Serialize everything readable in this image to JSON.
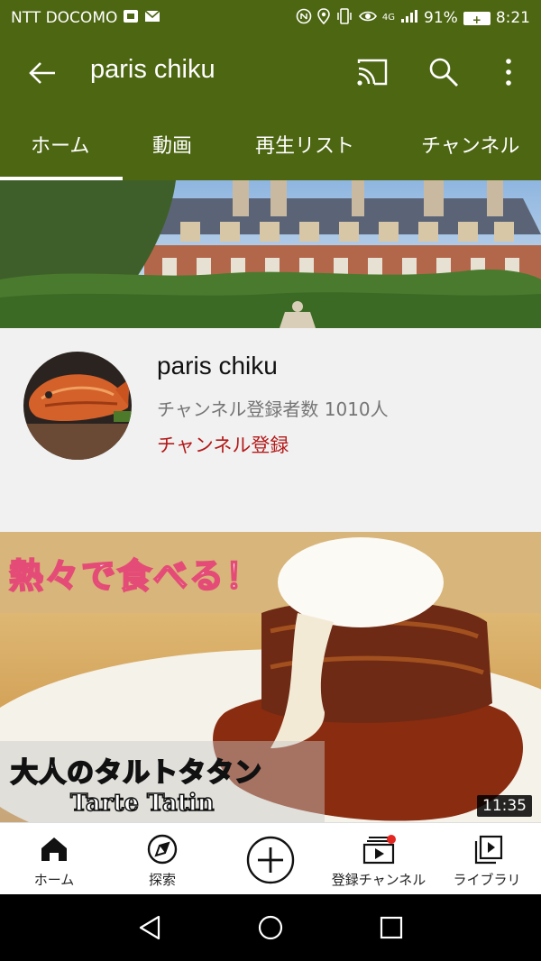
{
  "status_bar": {
    "carrier": "NTT DOCOMO",
    "network": "4G",
    "battery": "91%",
    "time": "8:21"
  },
  "app_bar": {
    "title": "paris chiku",
    "icons": [
      "back-arrow-icon",
      "cast-icon",
      "search-icon",
      "more-vert-icon"
    ]
  },
  "tabs": [
    {
      "label": "ホーム",
      "active": true
    },
    {
      "label": "動画"
    },
    {
      "label": "再生リスト"
    },
    {
      "label": "チャンネル"
    }
  ],
  "channel": {
    "name": "paris chiku",
    "subscribers": "チャンネル登録者数 1010人",
    "subscribe_label": "チャンネル登録"
  },
  "video": {
    "overlay_top": "熱々で食べる！",
    "overlay_title_jp": "大人のタルトタタン",
    "overlay_title_en": "Tarte Tatin",
    "duration": "11:35"
  },
  "bottom_nav": [
    {
      "label": "ホーム",
      "icon": "home-icon"
    },
    {
      "label": "探索",
      "icon": "explore-icon"
    },
    {
      "label": "",
      "icon": "create-icon"
    },
    {
      "label": "登録チャンネル",
      "icon": "subscriptions-icon"
    },
    {
      "label": "ライブラリ",
      "icon": "library-icon"
    }
  ],
  "colors": {
    "brand": "#4d6612",
    "subscribe": "#b41a1a"
  }
}
